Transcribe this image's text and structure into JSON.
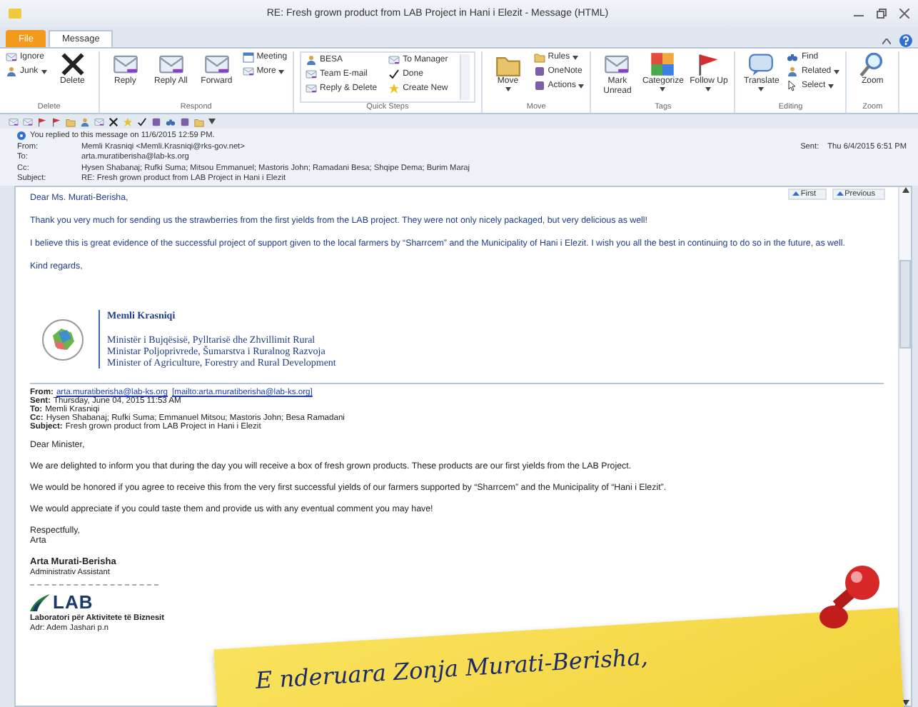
{
  "window": {
    "title": "RE: Fresh grown product from LAB Project in Hani i Elezit - Message (HTML)"
  },
  "ribbon": {
    "tabs": [
      {
        "label": "File",
        "selected": false
      },
      {
        "label": "Message",
        "selected": true
      }
    ],
    "groups": [
      {
        "label": "Delete",
        "kind": "commands",
        "items": [
          {
            "label": "Ignore",
            "kind": "small",
            "dropdown": false
          },
          {
            "label": "Junk",
            "kind": "small",
            "dropdown": true
          },
          {
            "label": "Delete",
            "kind": "large",
            "dropdown": false
          }
        ]
      },
      {
        "label": "Respond",
        "kind": "commands",
        "items": [
          {
            "label": "Reply",
            "kind": "large",
            "dropdown": false
          },
          {
            "label": "Reply All",
            "kind": "large",
            "dropdown": false
          },
          {
            "label": "Forward",
            "kind": "large",
            "dropdown": false
          },
          {
            "label": "Meeting",
            "kind": "small",
            "dropdown": false
          },
          {
            "label": "More",
            "kind": "small",
            "dropdown": true
          }
        ]
      },
      {
        "label": "Quick Steps",
        "kind": "gallery",
        "items": [
          {
            "label": "BESA",
            "kind": "small",
            "dropdown": false
          },
          {
            "label": "Team E-mail",
            "kind": "small",
            "dropdown": false
          },
          {
            "label": "Reply & Delete",
            "kind": "small",
            "dropdown": false
          },
          {
            "label": "To Manager",
            "kind": "small",
            "dropdown": false
          },
          {
            "label": "Done",
            "kind": "small",
            "dropdown": false
          },
          {
            "label": "Create New",
            "kind": "small",
            "dropdown": false
          }
        ]
      },
      {
        "label": "Move",
        "kind": "commands",
        "items": [
          {
            "label": "Move",
            "kind": "large",
            "dropdown": true
          },
          {
            "label": "Rules",
            "kind": "small",
            "dropdown": true
          },
          {
            "label": "OneNote",
            "kind": "small",
            "dropdown": false
          },
          {
            "label": "Actions",
            "kind": "small",
            "dropdown": true
          }
        ]
      },
      {
        "label": "Tags",
        "kind": "commands",
        "items": [
          {
            "label": "Mark Unread",
            "kind": "large",
            "dropdown": false
          },
          {
            "label": "Categorize",
            "kind": "large",
            "dropdown": true
          },
          {
            "label": "Follow Up",
            "kind": "large",
            "dropdown": true
          }
        ]
      },
      {
        "label": "Editing",
        "kind": "commands",
        "items": [
          {
            "label": "Translate",
            "kind": "large",
            "dropdown": true
          },
          {
            "label": "Find",
            "kind": "small",
            "dropdown": false
          },
          {
            "label": "Related",
            "kind": "small",
            "dropdown": true
          },
          {
            "label": "Select",
            "kind": "small",
            "dropdown": true
          }
        ]
      },
      {
        "label": "Zoom",
        "kind": "commands",
        "items": [
          {
            "label": "Zoom",
            "kind": "large",
            "dropdown": false
          }
        ]
      }
    ]
  },
  "header": {
    "notice": "You replied to this message on 11/6/2015 12:59 PM.",
    "fields": [
      {
        "label": "From:",
        "value": "Memli Krasniqi <Memli.Krasniqi@rks-gov.net>"
      },
      {
        "label": "To:",
        "value": "arta.muratiberisha@lab-ks.org"
      },
      {
        "label": "Cc:",
        "value": "Hysen Shabanaj; Rufki Suma; Mitsou Emmanuel; Mastoris John; Ramadani Besa; Shqipe Dema; Burim Maraj"
      },
      {
        "label": "Subject:",
        "value": "RE: Fresh grown product from LAB Project in Hani i Elezit"
      }
    ],
    "sent": {
      "label": "Sent:",
      "value": "Thu 6/4/2015 6:51 PM"
    }
  },
  "nav": [
    "First",
    "Previous"
  ],
  "reply": {
    "paragraphs": [
      "Dear Ms. Murati-Berisha,",
      "Thank you very much for sending us the strawberries from the first yields from the LAB project. They were not only nicely packaged, but very delicious as well!",
      "I believe this is great evidence of the successful project of support given to the local farmers by “Sharrcem” and the Municipality of Hani i Elezit. I wish you all the best in continuing to do so in the future, as well.",
      "Kind regards,"
    ],
    "signature": {
      "name": "Memli Krasniqi",
      "titles": [
        "Ministër i Bujqësisë, Pylltarisë dhe Zhvillimit Rural",
        "Ministar Poljoprivrede, Šumarstva i Ruralnog Razvoja",
        "Minister of Agriculture, Forestry and Rural Development"
      ]
    }
  },
  "quoted": {
    "fields": [
      {
        "label": "From:",
        "links": [
          "arta.muratiberisha@lab-ks.org",
          "[mailto:arta.muratiberisha@lab-ks.org]"
        ]
      },
      {
        "label": "Sent:",
        "value": "Thursday, June 04, 2015 11:53 AM"
      },
      {
        "label": "To:",
        "value": "Memli Krasniqi"
      },
      {
        "label": "Cc:",
        "value": "Hysen Shabanaj; Rufki Suma; Emmanuel Mitsou; Mastoris John; Besa Ramadani"
      },
      {
        "label": "Subject:",
        "value": "Fresh grown product from LAB Project in Hani i Elezit"
      }
    ],
    "paragraphs": [
      "Dear Minister,",
      "We are delighted to inform you that during the day you will receive a box of fresh grown products. These products are our first yields from the LAB Project.",
      "We would be honored if you agree to receive this from the very first successful yields of our farmers supported by “Sharrcem” and the Municipality of “Hani i Elezit”.",
      "We would appreciate if you could taste them and provide us with any eventual comment you may have!"
    ],
    "closing": [
      "Respectfully,",
      "Arta"
    ],
    "signature": {
      "name": "Arta Murati-Berisha",
      "role": "Administrativ Assistant",
      "logo": "LAB",
      "org": "Laboratori për Aktivitete të Biznesit",
      "address": "Adr: Adem Jashari p.n"
    }
  },
  "note": {
    "text": "E nderuara Zonja Murati-Berisha,"
  }
}
